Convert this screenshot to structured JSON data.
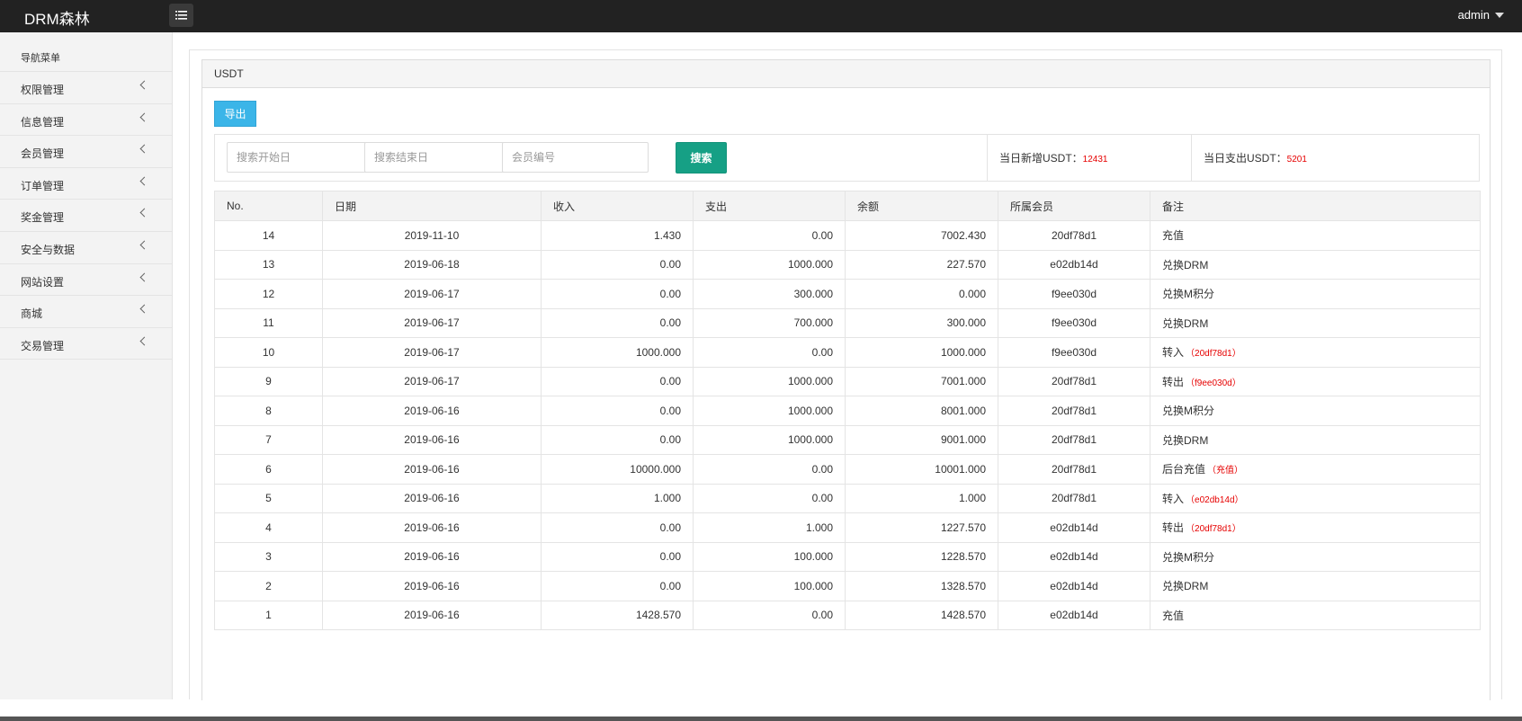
{
  "header": {
    "brand": "DRM森林",
    "user": "admin"
  },
  "sidebar": {
    "title": "导航菜单",
    "items": [
      {
        "label": "权限管理"
      },
      {
        "label": "信息管理"
      },
      {
        "label": "会员管理"
      },
      {
        "label": "订单管理"
      },
      {
        "label": "奖金管理"
      },
      {
        "label": "安全与数据"
      },
      {
        "label": "网站设置"
      },
      {
        "label": "商城"
      },
      {
        "label": "交易管理"
      }
    ]
  },
  "panel": {
    "title": "USDT",
    "export_label": "导出"
  },
  "search": {
    "start_placeholder": "搜索开始日",
    "end_placeholder": "搜索结束日",
    "member_placeholder": "会员编号",
    "button_label": "搜索",
    "stat_income_label": "当日新增USDT：",
    "stat_income_value": "12431",
    "stat_expense_label": "当日支出USDT：",
    "stat_expense_value": "5201"
  },
  "table": {
    "columns": [
      "No.",
      "日期",
      "收入",
      "支出",
      "余额",
      "所属会员",
      "备注"
    ],
    "rows": [
      {
        "no": "14",
        "date": "2019-11-10",
        "income": "1.430",
        "expense": "0.00",
        "balance": "7002.430",
        "member": "20df78d1",
        "note": "充值",
        "note_extra": ""
      },
      {
        "no": "13",
        "date": "2019-06-18",
        "income": "0.00",
        "expense": "1000.000",
        "balance": "227.570",
        "member": "e02db14d",
        "note": "兑换DRM",
        "note_extra": ""
      },
      {
        "no": "12",
        "date": "2019-06-17",
        "income": "0.00",
        "expense": "300.000",
        "balance": "0.000",
        "member": "f9ee030d",
        "note": "兑换M积分",
        "note_extra": ""
      },
      {
        "no": "11",
        "date": "2019-06-17",
        "income": "0.00",
        "expense": "700.000",
        "balance": "300.000",
        "member": "f9ee030d",
        "note": "兑换DRM",
        "note_extra": ""
      },
      {
        "no": "10",
        "date": "2019-06-17",
        "income": "1000.000",
        "expense": "0.00",
        "balance": "1000.000",
        "member": "f9ee030d",
        "note": "转入",
        "note_extra": "（20df78d1）"
      },
      {
        "no": "9",
        "date": "2019-06-17",
        "income": "0.00",
        "expense": "1000.000",
        "balance": "7001.000",
        "member": "20df78d1",
        "note": "转出",
        "note_extra": "（f9ee030d）"
      },
      {
        "no": "8",
        "date": "2019-06-16",
        "income": "0.00",
        "expense": "1000.000",
        "balance": "8001.000",
        "member": "20df78d1",
        "note": "兑换M积分",
        "note_extra": ""
      },
      {
        "no": "7",
        "date": "2019-06-16",
        "income": "0.00",
        "expense": "1000.000",
        "balance": "9001.000",
        "member": "20df78d1",
        "note": "兑换DRM",
        "note_extra": ""
      },
      {
        "no": "6",
        "date": "2019-06-16",
        "income": "10000.000",
        "expense": "0.00",
        "balance": "10001.000",
        "member": "20df78d1",
        "note": "后台充值",
        "note_extra": "（充值）"
      },
      {
        "no": "5",
        "date": "2019-06-16",
        "income": "1.000",
        "expense": "0.00",
        "balance": "1.000",
        "member": "20df78d1",
        "note": "转入",
        "note_extra": "（e02db14d）"
      },
      {
        "no": "4",
        "date": "2019-06-16",
        "income": "0.00",
        "expense": "1.000",
        "balance": "1227.570",
        "member": "e02db14d",
        "note": "转出",
        "note_extra": "（20df78d1）"
      },
      {
        "no": "3",
        "date": "2019-06-16",
        "income": "0.00",
        "expense": "100.000",
        "balance": "1228.570",
        "member": "e02db14d",
        "note": "兑换M积分",
        "note_extra": ""
      },
      {
        "no": "2",
        "date": "2019-06-16",
        "income": "0.00",
        "expense": "100.000",
        "balance": "1328.570",
        "member": "e02db14d",
        "note": "兑换DRM",
        "note_extra": ""
      },
      {
        "no": "1",
        "date": "2019-06-16",
        "income": "1428.570",
        "expense": "0.00",
        "balance": "1428.570",
        "member": "e02db14d",
        "note": "充值",
        "note_extra": ""
      }
    ]
  },
  "colors": {
    "topbar": "#222222",
    "export_button": "#3bb5e8",
    "search_button": "#16a085",
    "highlight_text": "#e60000"
  }
}
